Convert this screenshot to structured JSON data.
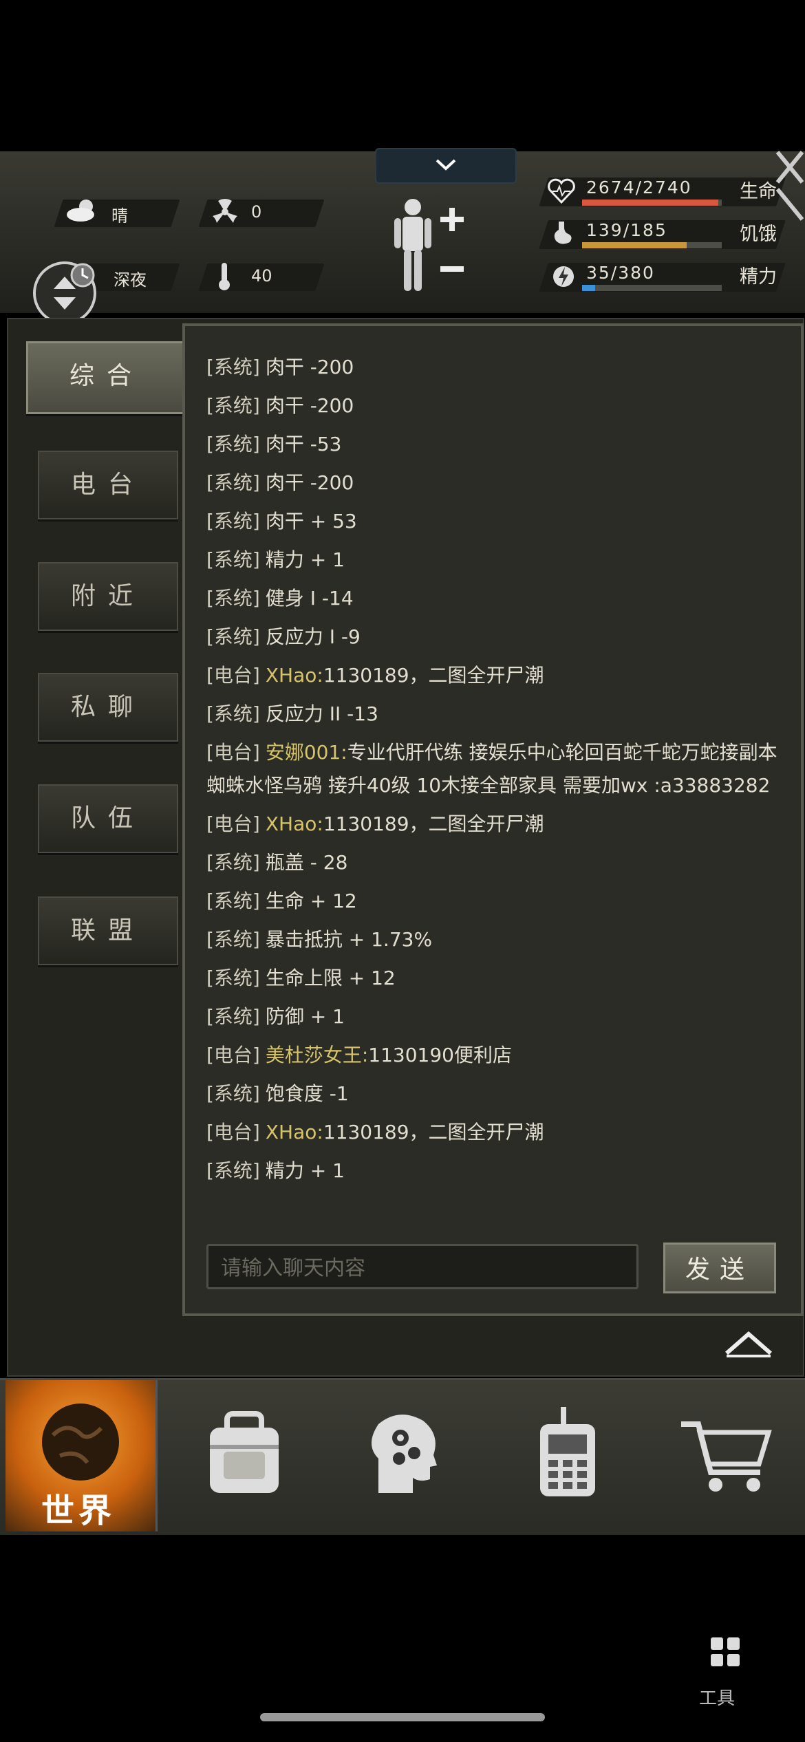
{
  "hud": {
    "weather": "晴",
    "radiation": "0",
    "time_of_day": "深夜",
    "temperature": "40",
    "stats": [
      {
        "value": "2674/2740",
        "label": "生命",
        "fill": 0.976,
        "color": "#d9573e"
      },
      {
        "value": "139/185",
        "label": "饥饿",
        "fill": 0.751,
        "color": "#c9973a"
      },
      {
        "value": "35/380",
        "label": "精力",
        "fill": 0.092,
        "color": "#3d8fd6"
      }
    ]
  },
  "tabs": [
    "综合",
    "电台",
    "附近",
    "私聊",
    "队伍",
    "联盟"
  ],
  "active_tab": "综合",
  "chat": {
    "messages": [
      {
        "tag": "[系统]",
        "user": "",
        "text": "肉干 -200"
      },
      {
        "tag": "[系统]",
        "user": "",
        "text": "肉干 -200"
      },
      {
        "tag": "[系统]",
        "user": "",
        "text": "肉干 -53"
      },
      {
        "tag": "[系统]",
        "user": "",
        "text": "肉干 -200"
      },
      {
        "tag": "[系统]",
        "user": "",
        "text": "肉干 + 53"
      },
      {
        "tag": "[系统]",
        "user": "",
        "text": "精力 + 1"
      },
      {
        "tag": "[系统]",
        "user": "",
        "text": "健身 I -14"
      },
      {
        "tag": "[系统]",
        "user": "",
        "text": "反应力 I -9"
      },
      {
        "tag": "[电台]",
        "user": "XHao:",
        "text": "1130189，二图全开尸潮"
      },
      {
        "tag": "[系统]",
        "user": "",
        "text": "反应力 II -13"
      },
      {
        "tag": "[电台]",
        "user": "安娜001:",
        "text": "专业代肝代练 接娱乐中心轮回百蛇千蛇万蛇接副本蜘蛛水怪乌鸦 接升40级 10木接全部家具 需要加wx :a33883282"
      },
      {
        "tag": "[电台]",
        "user": "XHao:",
        "text": "1130189，二图全开尸潮"
      },
      {
        "tag": "[系统]",
        "user": "",
        "text": "瓶盖 - 28"
      },
      {
        "tag": "[系统]",
        "user": "",
        "text": "生命 + 12"
      },
      {
        "tag": "[系统]",
        "user": "",
        "text": "暴击抵抗 + 1.73%"
      },
      {
        "tag": "[系统]",
        "user": "",
        "text": "生命上限 + 12"
      },
      {
        "tag": "[系统]",
        "user": "",
        "text": "防御 + 1"
      },
      {
        "tag": "[电台]",
        "user": "美杜莎女王:",
        "text": "1130190便利店"
      },
      {
        "tag": "[系统]",
        "user": "",
        "text": "饱食度 -1"
      },
      {
        "tag": "[电台]",
        "user": "XHao:",
        "text": "1130189，二图全开尸潮"
      },
      {
        "tag": "[系统]",
        "user": "",
        "text": "精力 + 1"
      }
    ],
    "input_placeholder": "请输入聊天内容",
    "send_label": "发送"
  },
  "bottom_nav": {
    "world_label": "世界",
    "icons": [
      "globe-icon",
      "backpack-icon",
      "brain-gears-icon",
      "walkie-talkie-icon",
      "shopping-cart-icon"
    ]
  },
  "tools_label": "工具"
}
